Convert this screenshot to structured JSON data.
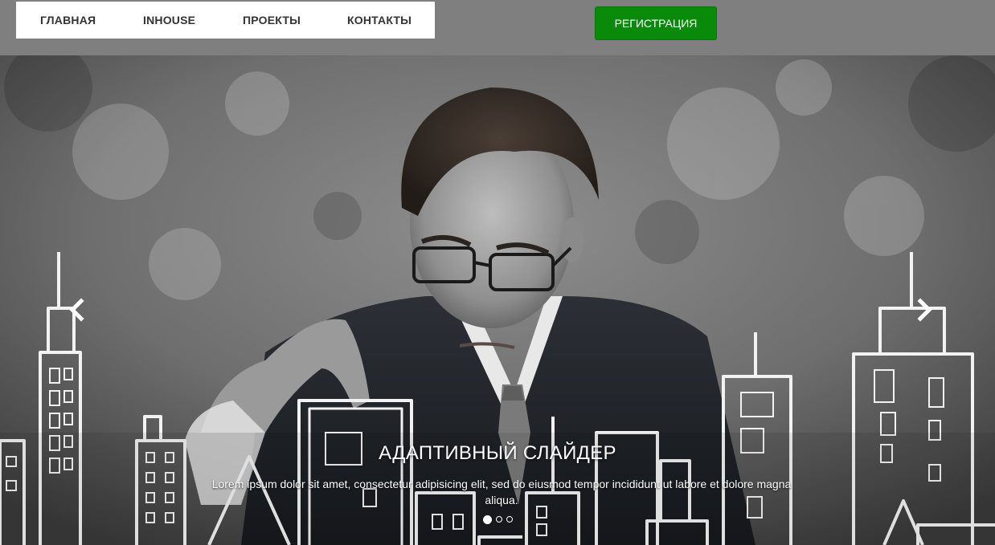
{
  "nav": {
    "items": [
      {
        "label": "ГЛАВНАЯ"
      },
      {
        "label": "INHOUSE"
      },
      {
        "label": "ПРОЕКТЫ"
      },
      {
        "label": "КОНТАКТЫ"
      }
    ]
  },
  "header": {
    "register_label": "РЕГИСТРАЦИЯ"
  },
  "slider": {
    "caption_title": "АДАПТИВНЫЙ СЛАЙДЕР",
    "caption_text": "Lorem ipsum dolor sit amet, consectetur adipisicing elit, sed do eiusmod tempor incididunt ut labore et dolore magna aliqua.",
    "slide_count": 3,
    "active_slide": 1,
    "prev_icon": "chevron-left-icon",
    "next_icon": "chevron-right-icon"
  },
  "colors": {
    "topbar": "#7f7f7f",
    "nav_bg": "#ffffff",
    "register_bg": "#0a8a0a",
    "nav_text": "#333333"
  }
}
